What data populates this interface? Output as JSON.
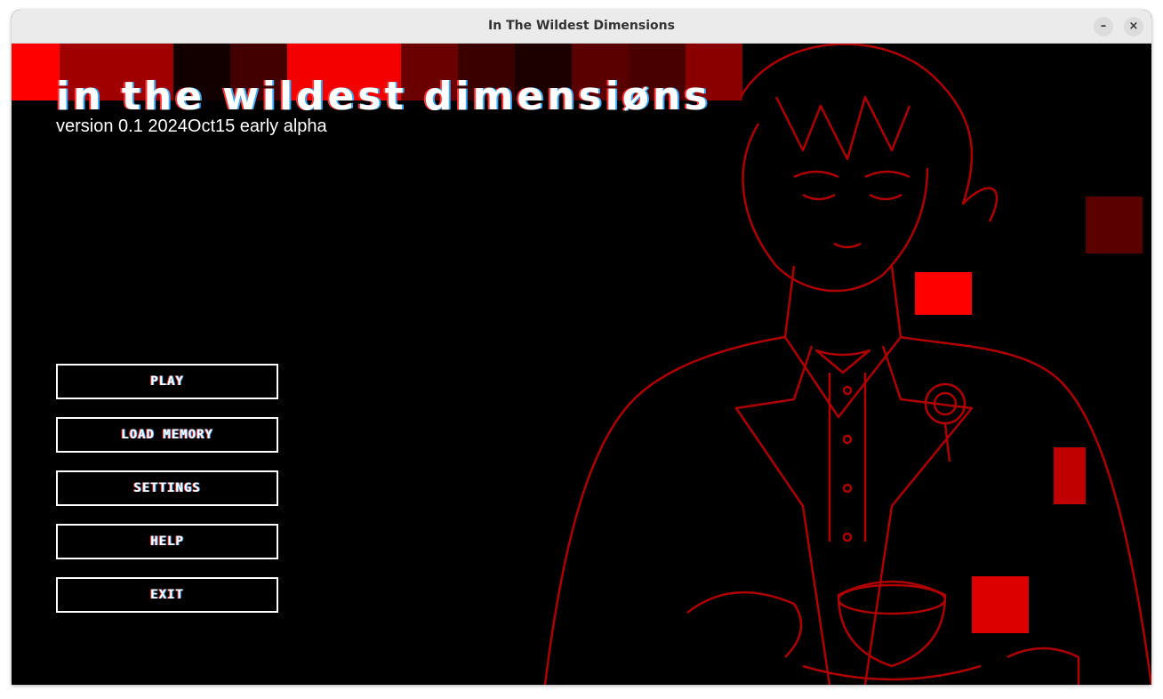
{
  "window": {
    "title": "In The Wildest Dimensions",
    "minimize_icon": "minimize-icon",
    "close_icon": "close-icon",
    "minimize_glyph": "–",
    "close_glyph": "×"
  },
  "game": {
    "logo": "IN THE WILDEST DIMENSIØNS",
    "version": "version 0.1 2024Oct15 early alpha",
    "menu": [
      {
        "label": "PLAY"
      },
      {
        "label": "LOAD MEMORY"
      },
      {
        "label": "SETTINGS"
      },
      {
        "label": "HELP"
      },
      {
        "label": "EXIT"
      }
    ],
    "colors": {
      "accent": "#ff0000",
      "line_art": "#b00000",
      "background": "#000000"
    }
  }
}
